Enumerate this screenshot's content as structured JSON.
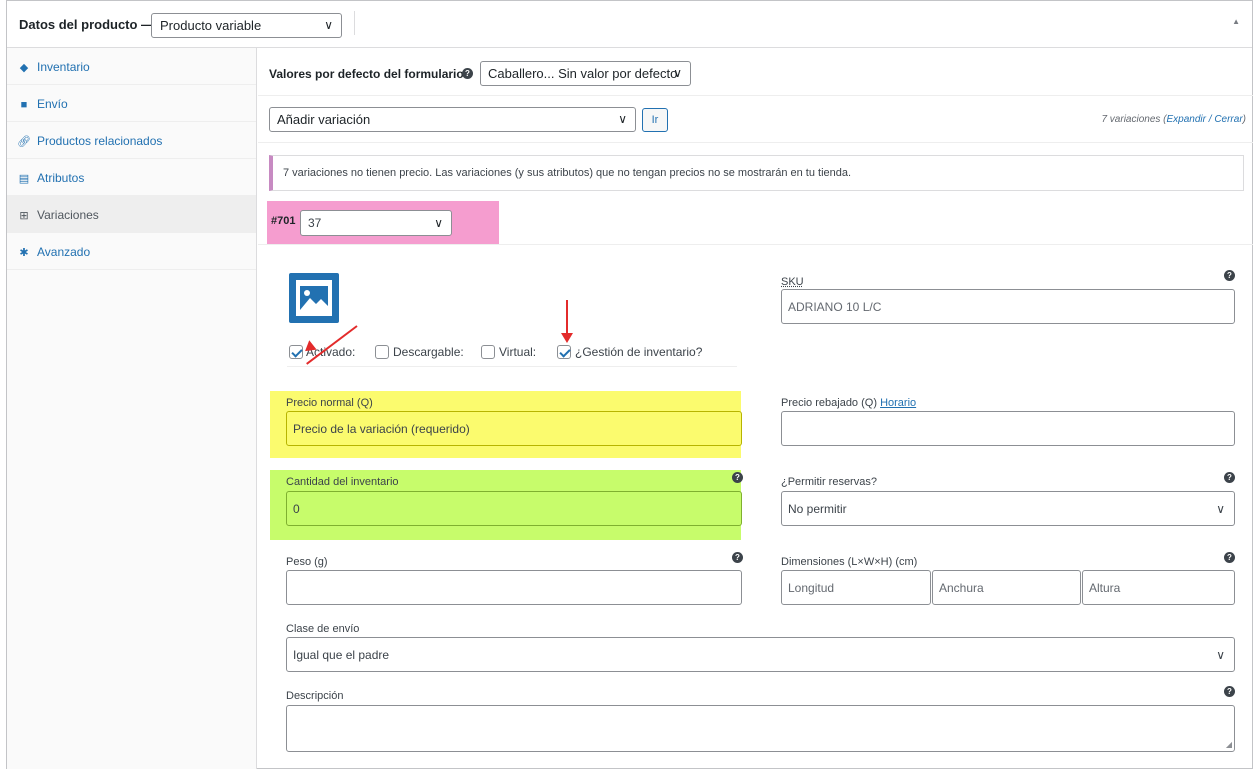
{
  "header": {
    "title": "Datos del producto —",
    "product_type": "Producto variable",
    "collapse_symbol": "▲"
  },
  "sidebar": {
    "items": [
      {
        "label": "Inventario",
        "icon": "tag-icon"
      },
      {
        "label": "Envío",
        "icon": "truck-icon"
      },
      {
        "label": "Productos relacionados",
        "icon": "link-icon"
      },
      {
        "label": "Atributos",
        "icon": "list-icon"
      },
      {
        "label": "Variaciones",
        "icon": "grid-icon",
        "active": true
      },
      {
        "label": "Avanzado",
        "icon": "gear-icon"
      }
    ]
  },
  "defaults": {
    "label": "Valores por defecto del formulario:",
    "value": "Caballero... Sin valor por defecto"
  },
  "add_variation": {
    "select_value": "Añadir variación",
    "go_label": "Ir",
    "count_text": "7 variaciones (",
    "expand_label": "Expandir",
    "separator": " / ",
    "collapse_label": "Cerrar",
    "close_paren": ")"
  },
  "notice": {
    "text": "7 variaciones no tienen precio. Las variaciones (y sus atributos) que no tengan precios no se mostrarán en tu tienda."
  },
  "variation": {
    "number": "#701",
    "size": "37",
    "options": {
      "enabled": {
        "label": "Activado:",
        "checked": true
      },
      "downloadable": {
        "label": "Descargable:",
        "checked": false
      },
      "virtual": {
        "label": "Virtual:",
        "checked": false
      },
      "manage_stock": {
        "label": "¿Gestión de inventario?",
        "checked": true
      }
    },
    "sku": {
      "label": "SKU",
      "placeholder": "ADRIANO 10 L/C"
    },
    "regular_price": {
      "label": "Precio normal (Q)",
      "placeholder": "Precio de la variación (requerido)"
    },
    "sale_price": {
      "label": "Precio rebajado (Q)",
      "schedule_link": "Horario",
      "value": ""
    },
    "stock_qty": {
      "label": "Cantidad del inventario",
      "value": "0"
    },
    "backorders": {
      "label": "¿Permitir reservas?",
      "value": "No permitir"
    },
    "weight": {
      "label": "Peso (g)",
      "value": ""
    },
    "dimensions": {
      "label": "Dimensiones (L×W×H) (cm)",
      "length": "Longitud",
      "width": "Anchura",
      "height": "Altura"
    },
    "shipping_class": {
      "label": "Clase de envío",
      "value": "Igual que el padre"
    },
    "description": {
      "label": "Descripción",
      "value": ""
    }
  },
  "colors": {
    "accent": "#2271b1",
    "highlight_pink": "#f59dcf",
    "highlight_yellow": "#fbfb6e",
    "highlight_green": "#c7fc6b",
    "arrow_red": "#e32b2b"
  }
}
